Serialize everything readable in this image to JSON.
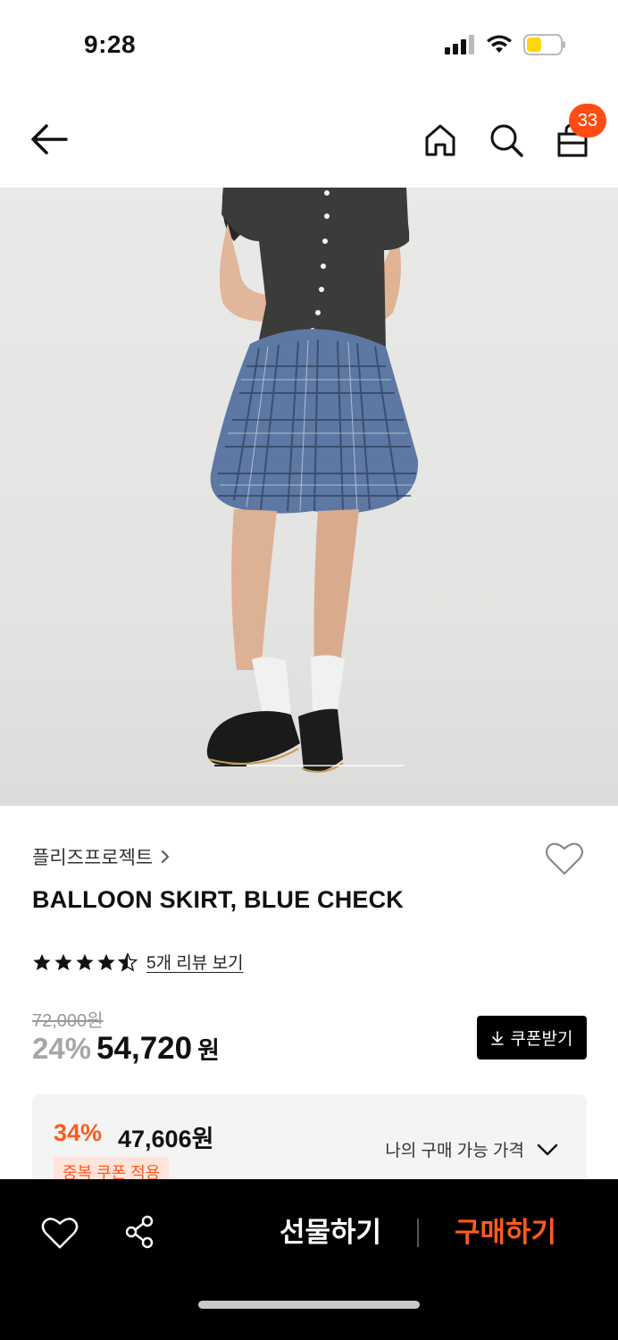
{
  "status_bar": {
    "time": "9:28"
  },
  "header": {
    "cart_count": "33"
  },
  "image": {
    "carousel_progress": 0.17
  },
  "product": {
    "brand": "플리즈프로젝트",
    "title": "BALLOON SKIRT, BLUE CHECK",
    "rating_stars": 4.5,
    "review_link": "5개 리뷰 보기",
    "original_price": "72,000원",
    "discount_rate": "24%",
    "sale_price": "54,720",
    "currency": "원",
    "coupon_button": "쿠폰받기"
  },
  "my_price": {
    "discount_rate": "34%",
    "price": "47,606원",
    "label": "나의 구매 가능 가격",
    "badge": "중복 쿠폰 적용"
  },
  "bottom_bar": {
    "gift_label": "선물하기",
    "buy_label": "구매하기"
  },
  "colors": {
    "accent": "#ff5a1f",
    "badge": "#ff4b14",
    "bar_bg": "#000000"
  }
}
